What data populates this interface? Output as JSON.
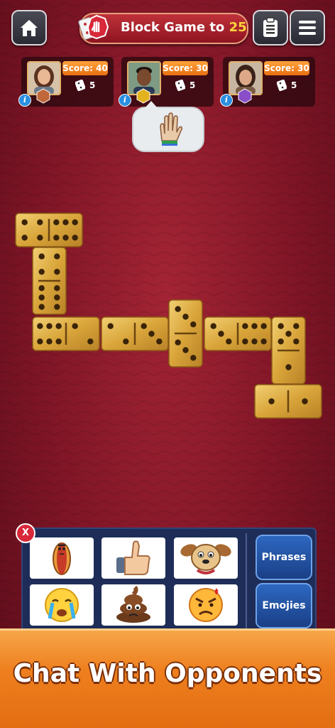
{
  "header": {
    "title_prefix": "Block Game to ",
    "title_target": "25",
    "home_icon": "home-icon",
    "notes_icon": "clipboard-icon",
    "menu_icon": "hamburger-icon"
  },
  "players": [
    {
      "score_label": "Score: 40",
      "tiles": "5",
      "badge_color": "#c0683a",
      "skin": "#e9b894",
      "hair": "#5a3220",
      "shirt": "#6a7a8a"
    },
    {
      "score_label": "Score: 30",
      "tiles": "5",
      "badge_color": "#e3b21f",
      "skin": "#7a4a2e",
      "hair": "#1e1410",
      "shirt": "#2b3a55"
    },
    {
      "score_label": "Score: 30",
      "tiles": "5",
      "badge_color": "#8a4fc8",
      "skin": "#dca888",
      "hair": "#3a2218",
      "shirt": "#7b5b45"
    }
  ],
  "chat_bubble_icon": "waving-hand-icon",
  "dominoes": [
    {
      "orientation": "h",
      "a": 4,
      "b": 6
    },
    {
      "orientation": "v",
      "a": 4,
      "b": 6
    },
    {
      "orientation": "h",
      "a": 6,
      "b": 2
    },
    {
      "orientation": "h",
      "a": 2,
      "b": 3
    },
    {
      "orientation": "v",
      "a": 3,
      "b": 3
    },
    {
      "orientation": "h",
      "a": 3,
      "b": 6
    },
    {
      "orientation": "v",
      "a": 5,
      "b": 1
    },
    {
      "orientation": "h",
      "a": 1,
      "b": 1
    }
  ],
  "chat_panel": {
    "emojis": [
      "hotdog-sticker-icon",
      "thumbs-up-sticker-icon",
      "crying-dog-sticker-icon",
      "crying-face-icon",
      "poop-face-icon",
      "angry-face-icon"
    ],
    "phrases_label": "Phrases",
    "emojies_label": "Emojies",
    "close_label": "X"
  },
  "banner": {
    "text": "Chat With Opponents"
  },
  "colors": {
    "felt": "#7e1526",
    "domino_gold": "#d9a53a",
    "panel_blue": "#1e2d58",
    "banner_orange": "#ee7f1e"
  }
}
